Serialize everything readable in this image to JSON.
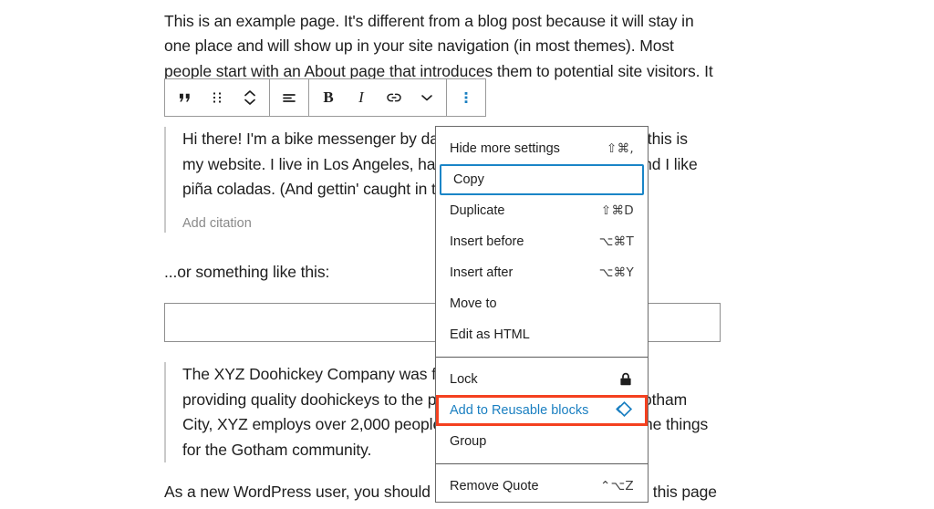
{
  "document": {
    "intro_paragraph": "This is an example page. It's different from a blog post because it will stay in one place and will show up in your site navigation (in most themes). Most people start with an About page that introduces them to potential site visitors. It might say",
    "quote_one": {
      "text": "Hi there! I'm a bike messenger by day, aspiring actor by night, and this is my website. I live in Los Angeles, have a great dog named Jack, and I like piña coladas. (And gettin' caught in the rain.)",
      "citation_placeholder": "Add citation"
    },
    "something_paragraph": "...or something like this:",
    "empty_block": {
      "value": ""
    },
    "quote_two": {
      "text": "The XYZ Doohickey Company was founded in 1971, and has been providing quality doohickeys to the public ever since. Located in Gotham City, XYZ employs over 2,000 people and does all kinds of awesome things for the Gotham community."
    },
    "newuser_paragraph": "As a new WordPress user, you should go to your dashboard to delete this page"
  },
  "toolbar": {
    "buttons": [
      {
        "name": "quote-icon",
        "label": "Quote"
      },
      {
        "name": "drag-handle-icon",
        "label": "Drag"
      },
      {
        "name": "move-updown-icon",
        "label": "Move up or down"
      },
      {
        "name": "align-left-icon",
        "label": "Change alignment"
      },
      {
        "name": "bold-icon",
        "label": "B"
      },
      {
        "name": "italic-icon",
        "label": "I"
      },
      {
        "name": "link-icon",
        "label": "Link"
      },
      {
        "name": "more-formats-chevron-icon",
        "label": "More rich text controls"
      },
      {
        "name": "options-vertical-dots-icon",
        "label": "Options"
      }
    ],
    "bold_label": "B",
    "italic_label": "I",
    "active_color": "#1a7fc1"
  },
  "menu": {
    "items": [
      {
        "label": "Hide more settings",
        "shortcut": "⇧⌘,",
        "icon": "",
        "state": "normal"
      },
      {
        "label": "Copy",
        "shortcut": "",
        "icon": "",
        "state": "focused"
      },
      {
        "label": "Duplicate",
        "shortcut": "⇧⌘D",
        "icon": "",
        "state": "normal"
      },
      {
        "label": "Insert before",
        "shortcut": "⌥⌘T",
        "icon": "",
        "state": "normal"
      },
      {
        "label": "Insert after",
        "shortcut": "⌥⌘Y",
        "icon": "",
        "state": "normal"
      },
      {
        "label": "Move to",
        "shortcut": "",
        "icon": "",
        "state": "normal"
      },
      {
        "label": "Edit as HTML",
        "shortcut": "",
        "icon": "",
        "state": "normal"
      },
      {
        "label": "Lock",
        "shortcut": "",
        "icon": "lock-icon",
        "state": "normal"
      },
      {
        "label": "Add to Reusable blocks",
        "shortcut": "",
        "icon": "reusable-block-icon",
        "state": "highlighted"
      },
      {
        "label": "Group",
        "shortcut": "",
        "icon": "",
        "state": "normal"
      },
      {
        "label": "Remove Quote",
        "shortcut": "⌃⌥Z",
        "icon": "",
        "state": "normal"
      }
    ],
    "focus_outline_color": "#1a85c7",
    "highlight_outline_color": "#f4401f",
    "highlight_text_color": "#1a7fc1"
  }
}
